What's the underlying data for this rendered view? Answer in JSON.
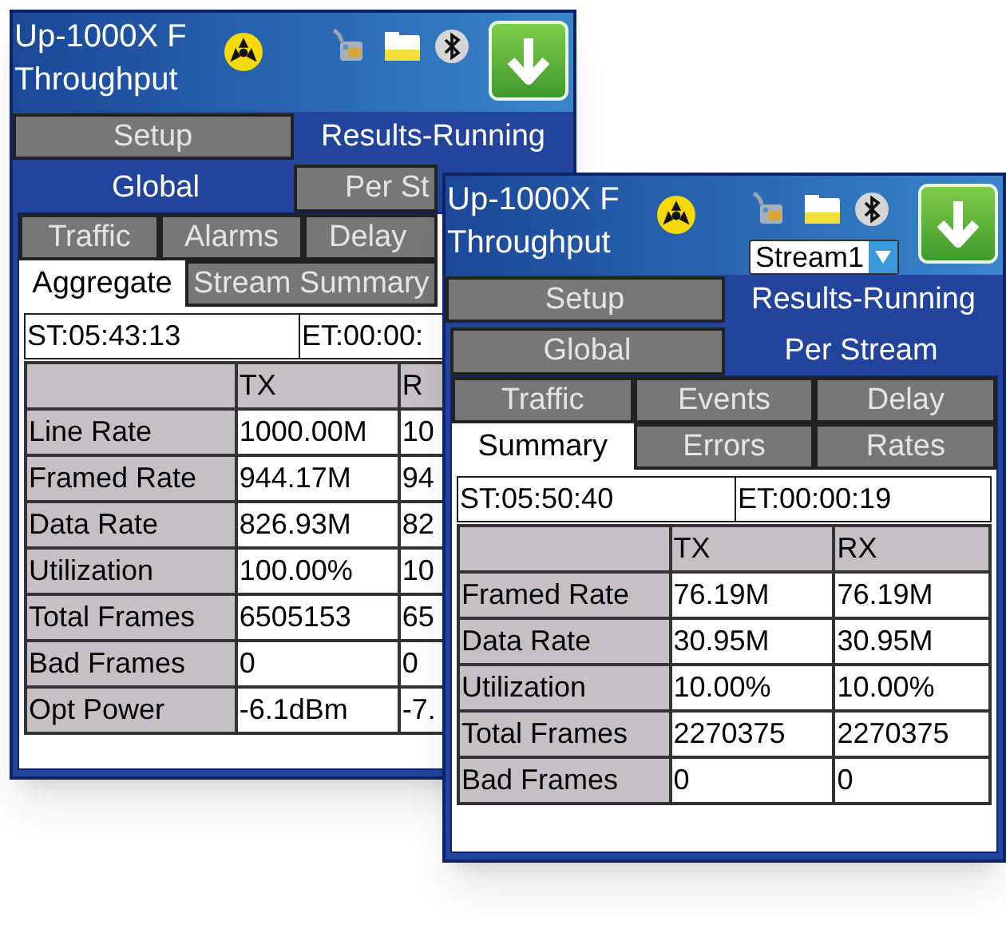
{
  "windows": [
    {
      "title_lines": [
        "Up-1000X F",
        "Throughput"
      ],
      "main_tabs": [
        {
          "label": "Setup",
          "selected": false
        },
        {
          "label": "Results-Running",
          "selected": true
        }
      ],
      "view_tabs": [
        {
          "label": "Global",
          "selected": true
        },
        {
          "label": "Per St",
          "selected": false
        }
      ],
      "detail_tabs": [
        [
          {
            "label": "Traffic",
            "selected": false
          },
          {
            "label": "Alarms",
            "selected": false
          },
          {
            "label": "Delay",
            "selected": false
          }
        ],
        [
          {
            "label": "Aggregate",
            "selected": true
          },
          {
            "label": "Stream Summary",
            "selected": false
          }
        ]
      ],
      "start_time": "ST:05:43:13",
      "elapsed_time": "ET:00:00:",
      "table": {
        "columns": [
          "TX",
          "R"
        ],
        "rows": [
          {
            "label": "Line Rate",
            "values": [
              "1000.00M",
              "10"
            ]
          },
          {
            "label": "Framed Rate",
            "values": [
              "944.17M",
              "94"
            ]
          },
          {
            "label": "Data Rate",
            "values": [
              "826.93M",
              "82"
            ]
          },
          {
            "label": "Utilization",
            "values": [
              "100.00%",
              "10"
            ]
          },
          {
            "label": "Total Frames",
            "values": [
              "6505153",
              "65"
            ]
          },
          {
            "label": "Bad Frames",
            "values": [
              "0",
              "0"
            ]
          },
          {
            "label": "Opt Power",
            "values": [
              "-6.1dBm",
              "-7."
            ]
          }
        ]
      }
    },
    {
      "title_lines": [
        "Up-1000X F",
        "Throughput"
      ],
      "stream_selector": "Stream1",
      "main_tabs": [
        {
          "label": "Setup",
          "selected": false
        },
        {
          "label": "Results-Running",
          "selected": true
        }
      ],
      "view_tabs": [
        {
          "label": "Global",
          "selected": false
        },
        {
          "label": "Per Stream",
          "selected": true
        }
      ],
      "detail_tabs": [
        [
          {
            "label": "Traffic",
            "selected": false
          },
          {
            "label": "Events",
            "selected": false
          },
          {
            "label": "Delay",
            "selected": false
          }
        ],
        [
          {
            "label": "Summary",
            "selected": true
          },
          {
            "label": "Errors",
            "selected": false
          },
          {
            "label": "Rates",
            "selected": false
          }
        ]
      ],
      "start_time": "ST:05:50:40",
      "elapsed_time": "ET:00:00:19",
      "table": {
        "columns": [
          "TX",
          "RX"
        ],
        "rows": [
          {
            "label": "Framed Rate",
            "values": [
              "76.19M",
              "76.19M"
            ]
          },
          {
            "label": "Data Rate",
            "values": [
              "30.95M",
              "30.95M"
            ]
          },
          {
            "label": "Utilization",
            "values": [
              "10.00%",
              "10.00%"
            ]
          },
          {
            "label": "Total Frames",
            "values": [
              "2270375",
              "2270375"
            ]
          },
          {
            "label": "Bad Frames",
            "values": [
              "0",
              "0"
            ]
          }
        ]
      }
    }
  ]
}
